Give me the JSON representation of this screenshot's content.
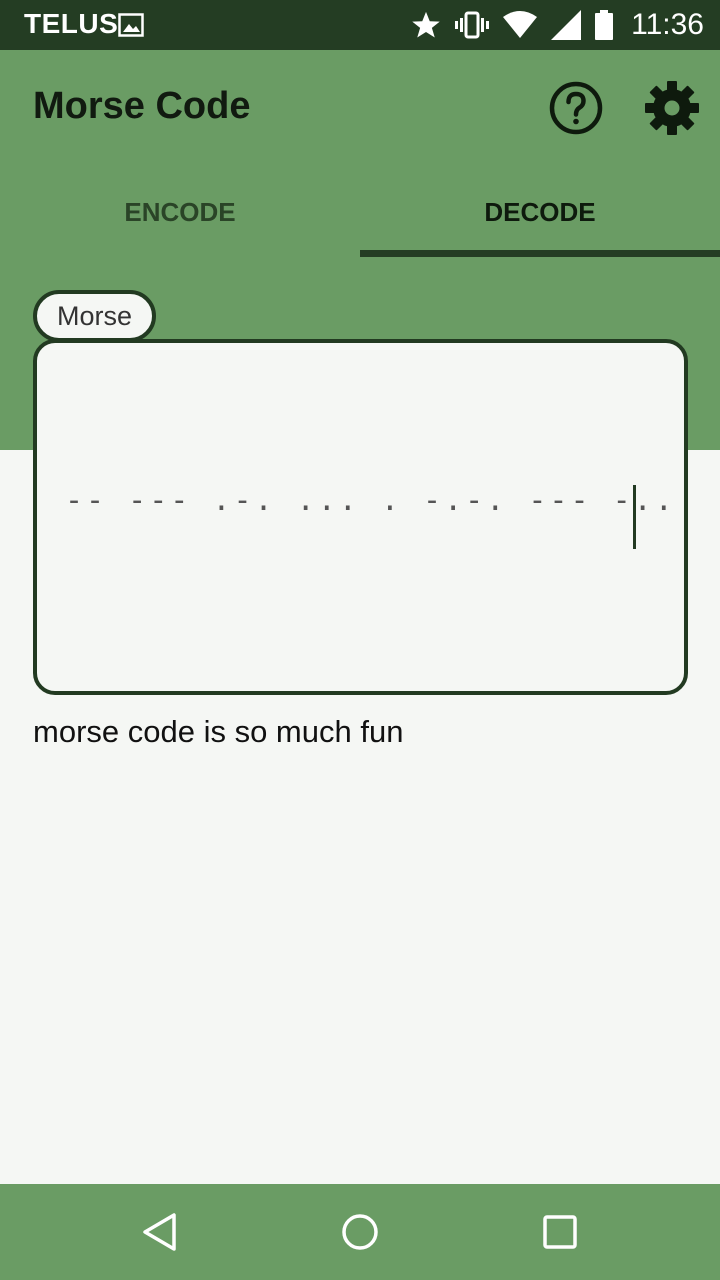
{
  "status_bar": {
    "carrier": "TELUS",
    "time": "11:36",
    "icons": [
      "image-icon",
      "star-icon",
      "vibrate-icon",
      "wifi-icon",
      "signal-icon",
      "battery-icon"
    ]
  },
  "app_bar": {
    "title": "Morse Code",
    "help_icon": "help-circle-icon",
    "settings_icon": "gear-icon"
  },
  "tabs": [
    {
      "label": "ENCODE",
      "selected": false
    },
    {
      "label": "DECODE",
      "selected": true
    }
  ],
  "input": {
    "label": "Morse",
    "value": "-- --- .-. ... .   -.-. --- -.. .   .. ...   ..."
  },
  "output": {
    "text": "morse code is so much fun"
  },
  "colors": {
    "primary": "#6a9c64",
    "primary_dark": "#243d23",
    "background": "#f5f7f4"
  },
  "nav_bar": {
    "icons": [
      "back-icon",
      "home-icon",
      "recents-icon"
    ]
  }
}
